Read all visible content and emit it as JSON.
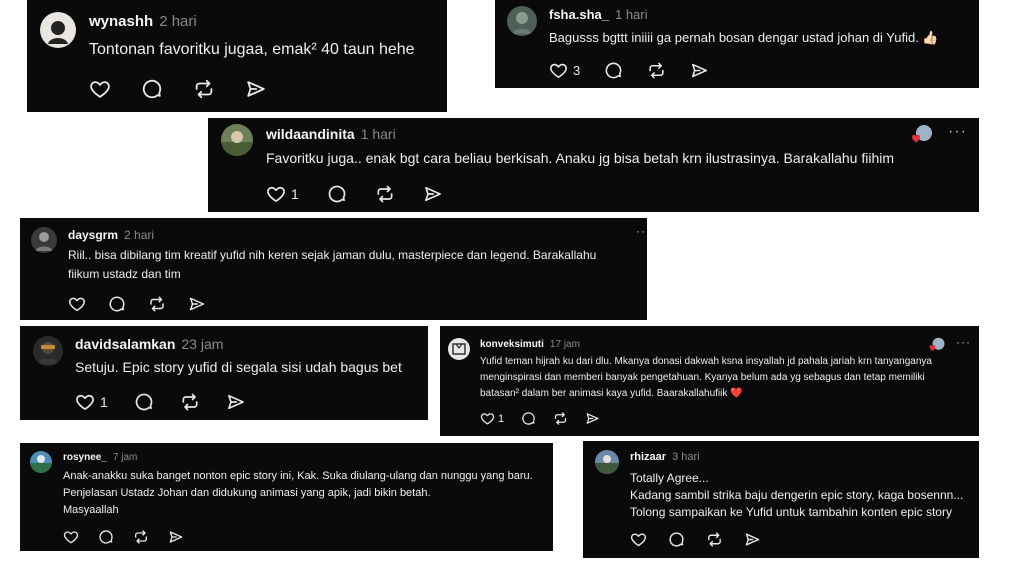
{
  "comments": [
    {
      "username": "wynashh",
      "time": "2 hari",
      "text": "Tontonan favoritku jugaa, emak² 40 taun hehe",
      "likes": ""
    },
    {
      "username": "fsha.sha_",
      "time": "1 hari",
      "text": "Bagusss bgttt iniiii ga pernah bosan dengar ustad johan di Yufid. 👍🏻",
      "likes": "3"
    },
    {
      "username": "wildaandinita",
      "time": "1 hari",
      "text": "Favoritku juga.. enak bgt cara beliau berkisah. Anaku jg bisa betah krn ilustrasinya. Barakallahu fiihim",
      "likes": "1",
      "more": "···"
    },
    {
      "username": "daysgrm",
      "time": "2 hari",
      "lines": [
        "Riil.. bisa dibilang tim kreatif yufid nih keren sejak jaman dulu, masterpiece dan legend. Barakallahu",
        "fiikum ustadz dan tim"
      ],
      "likes": "",
      "more": "··"
    },
    {
      "username": "davidsalamkan",
      "time": "23 jam",
      "text": "Setuju. Epic story yufid di segala sisi udah bagus bet",
      "likes": "1"
    },
    {
      "username": "konveksimuti",
      "time": "17 jam",
      "lines": [
        "Yufid teman hijrah ku dari dlu. Mkanya donasi dakwah ksna insyallah jd pahala jariah krn tanyanganya",
        "menginspirasi dan memberi banyak pengetahuan. Kyanya belum ada yg sebagus dan tetap memiliki",
        "batasan² dalam ber animasi kaya yufid. Baarakallahufiik ❤️"
      ],
      "likes": "1",
      "more": "···"
    },
    {
      "username": "rosynee_",
      "time": "7 jam",
      "lines": [
        "Anak-anakku suka banget nonton epic story ini, Kak. Suka diulang-ulang dan nunggu yang baru.",
        "Penjelasan Ustadz Johan dan didukung animasi yang apik, jadi bikin betah.",
        "Masyaallah"
      ],
      "likes": ""
    },
    {
      "username": "rhizaar",
      "time": "3 hari",
      "lines": [
        "Totally Agree...",
        "Kadang sambil strika baju dengerin epic story, kaga bosennn...",
        "Tolong sampaikan ke Yufid untuk tambahin konten epic story"
      ],
      "likes": ""
    }
  ],
  "icons": [
    "heart-icon",
    "comment-icon",
    "repost-icon",
    "share-icon"
  ],
  "colors": {
    "card_bg": "#0a0a0a",
    "text": "#eeeeee",
    "muted": "#8a8a8a",
    "page_bg": "#ffffff"
  }
}
